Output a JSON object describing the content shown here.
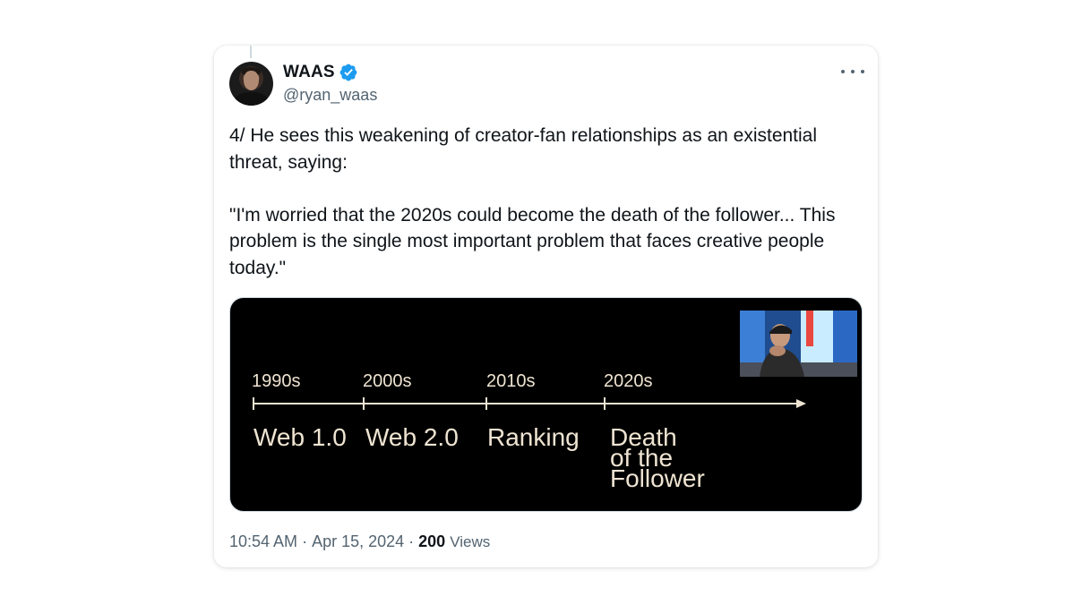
{
  "tweet": {
    "display_name": "WAAS",
    "handle": "@ryan_waas",
    "text": "4/ He sees this weakening of creator-fan relationships as an existential threat, saying:\n\n\"I'm worried that the 2020s could become the death of the follower... This problem is the single most important problem that faces creative people today.\"",
    "time": "10:54 AM",
    "separator": "·",
    "date": "Apr 15, 2024",
    "views_count": "200",
    "views_label": "Views"
  },
  "media": {
    "timeline": {
      "decades": [
        "1990s",
        "2000s",
        "2010s",
        "2020s"
      ],
      "eras": [
        "Web 1.0",
        "Web 2.0",
        "Ranking"
      ],
      "last_era_lines": [
        "Death",
        "of the",
        "Follower"
      ]
    }
  },
  "colors": {
    "verified": "#1d9bf0",
    "text": "#0f1419",
    "muted": "#536471",
    "timeline": "#efe4d2"
  },
  "icons": {
    "verified": "verified-badge-icon",
    "more": "more-horizontal-icon"
  }
}
